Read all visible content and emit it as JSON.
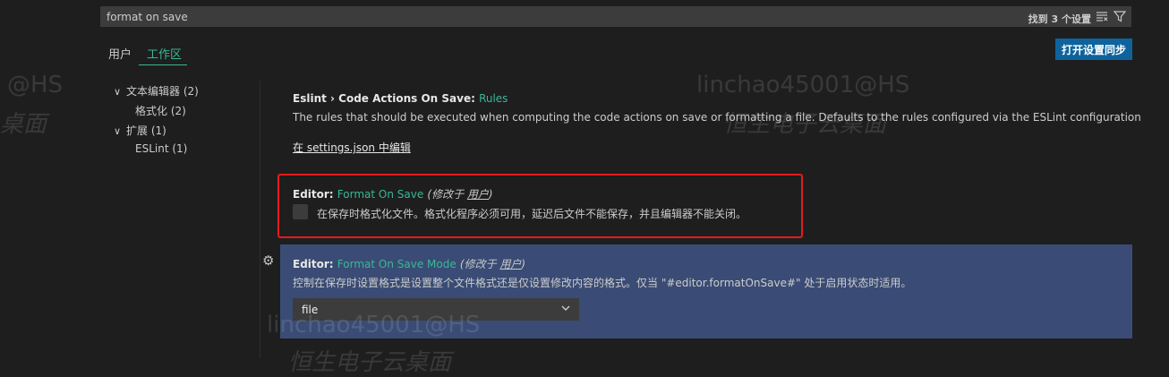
{
  "search": {
    "value": "format on save",
    "found_text": "找到 3 个设置"
  },
  "icons": {
    "clear_filter": "clear-filter-icon",
    "filter": "filter-icon",
    "chevron_down": "chevron-down-icon",
    "gear": "gear-icon"
  },
  "tabs": [
    {
      "label": "用户"
    },
    {
      "label": "工作区"
    }
  ],
  "toolbar": {
    "sync_label": "打开设置同步"
  },
  "toc": {
    "items": [
      {
        "label": "文本编辑器 (2)",
        "expanded": true
      },
      {
        "label": "格式化 (2)"
      },
      {
        "label": "扩展 (1)",
        "expanded": true
      },
      {
        "label": "ESLint (1)"
      }
    ]
  },
  "settings": [
    {
      "category": "Eslint › Code Actions On Save: ",
      "name": "Rules",
      "description": "The rules that should be executed when computing the code actions on save or formatting a file. Defaults to the rules configured via the ESLint configuration",
      "link": "在 settings.json 中编辑"
    },
    {
      "category": "Editor: ",
      "name": "Format On Save",
      "modified_prefix": "(修改于 ",
      "modified_scope": "用户",
      "modified_suffix": ")",
      "description": "在保存时格式化文件。格式化程序必须可用，延迟后文件不能保存，并且编辑器不能关闭。",
      "checked": false
    },
    {
      "category": "Editor: ",
      "name": "Format On Save Mode",
      "modified_prefix": "(修改于 ",
      "modified_scope": "用户",
      "modified_suffix": ")",
      "description": "控制在保存时设置格式是设置整个文件格式还是仅设置修改内容的格式。仅当 \"#editor.formatOnSave#\" 处于启用状态时适用。",
      "value": "file"
    }
  ],
  "watermarks": [
    "@HS",
    "桌面",
    "linchao45001@HS",
    "恒生电子云桌面",
    "linchao45001@HS",
    "恒生电子云桌面"
  ],
  "colors": {
    "accent_green": "#3ab795",
    "button_blue": "#0e639c",
    "highlight_row": "#3a4c75",
    "annotation_red": "#e51b1b"
  }
}
